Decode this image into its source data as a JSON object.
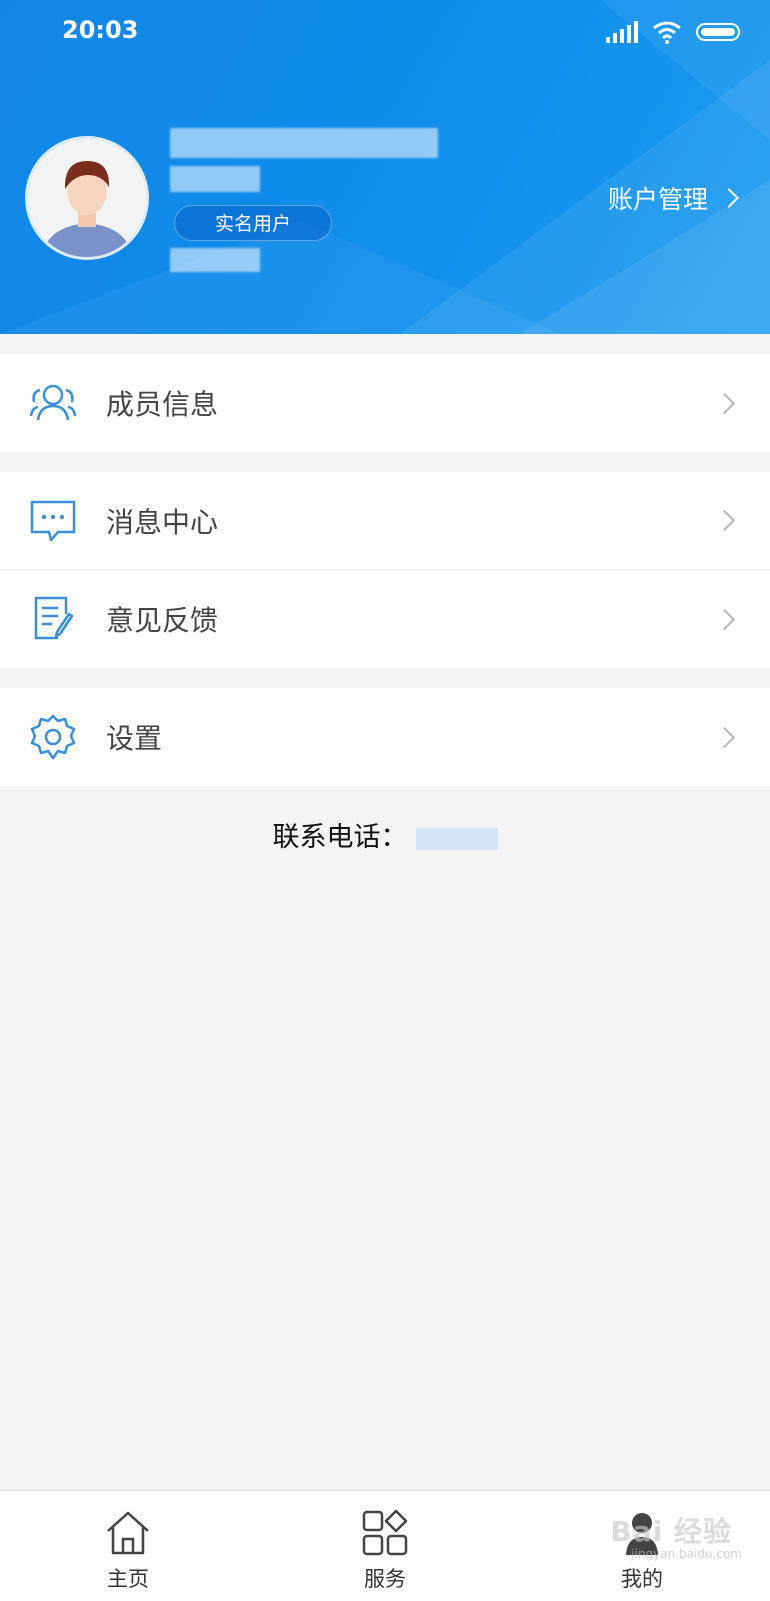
{
  "status_bar": {
    "time": "20:03"
  },
  "profile": {
    "badge": "实名用户",
    "account_management": "账户管理"
  },
  "menu": {
    "members": "成员信息",
    "messages": "消息中心",
    "feedback": "意见反馈",
    "settings": "设置"
  },
  "contact": {
    "label": "联系电话："
  },
  "tabbar": {
    "home": "主页",
    "services": "服务",
    "mine": "我的"
  },
  "watermark": {
    "text": "Bai 经验",
    "sub": "jingyan.baidu.com"
  },
  "colors": {
    "header_blue": "#1485e6",
    "icon_blue": "#3b8fd8",
    "page_bg": "#f4f4f4"
  }
}
